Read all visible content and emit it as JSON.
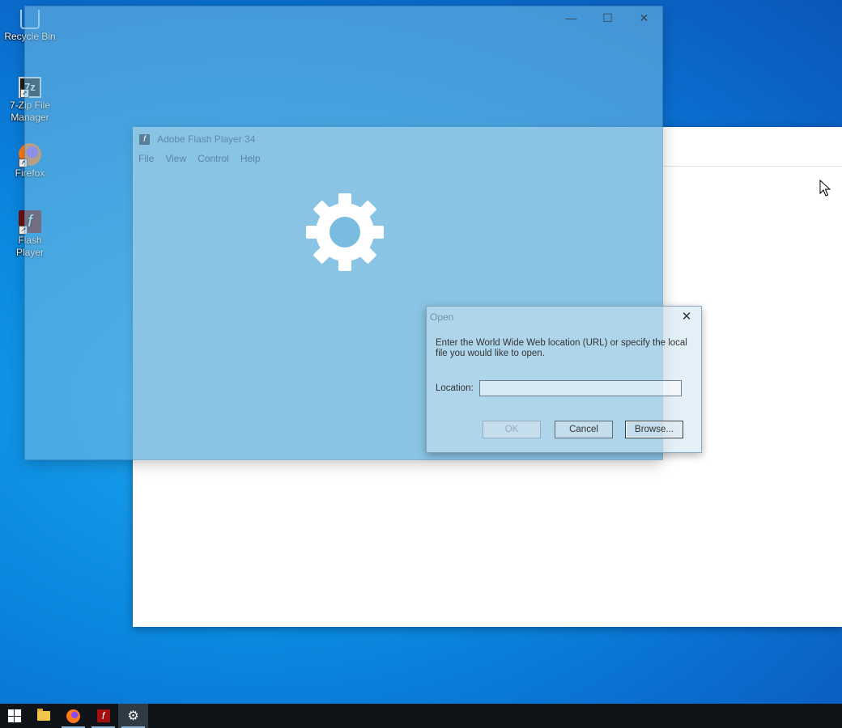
{
  "desktop": {
    "icons": [
      {
        "label": "Recycle Bin"
      },
      {
        "label": "7-Zip File Manager",
        "glyph": "7z"
      },
      {
        "label": "Firefox"
      },
      {
        "label": "Flash Player",
        "glyph": "f"
      }
    ]
  },
  "settings_window": {
    "minimize": "—",
    "maximize": "☐",
    "close": "✕"
  },
  "flash_window": {
    "title": "Adobe Flash Player 34",
    "menu": [
      "File",
      "View",
      "Control",
      "Help"
    ]
  },
  "open_dialog": {
    "title": "Open",
    "close": "✕",
    "message": "Enter the World Wide Web location (URL) or specify the local file you would like to open.",
    "location_label": "Location:",
    "location_value": "",
    "ok_label": "OK",
    "cancel_label": "Cancel",
    "browse_label": "Browse..."
  },
  "taskbar": {
    "items": [
      "start",
      "file-explorer",
      "firefox",
      "flash-player",
      "settings"
    ],
    "active": "settings"
  },
  "colors": {
    "accent": "#0a8ae0",
    "taskbar": "#101418"
  }
}
